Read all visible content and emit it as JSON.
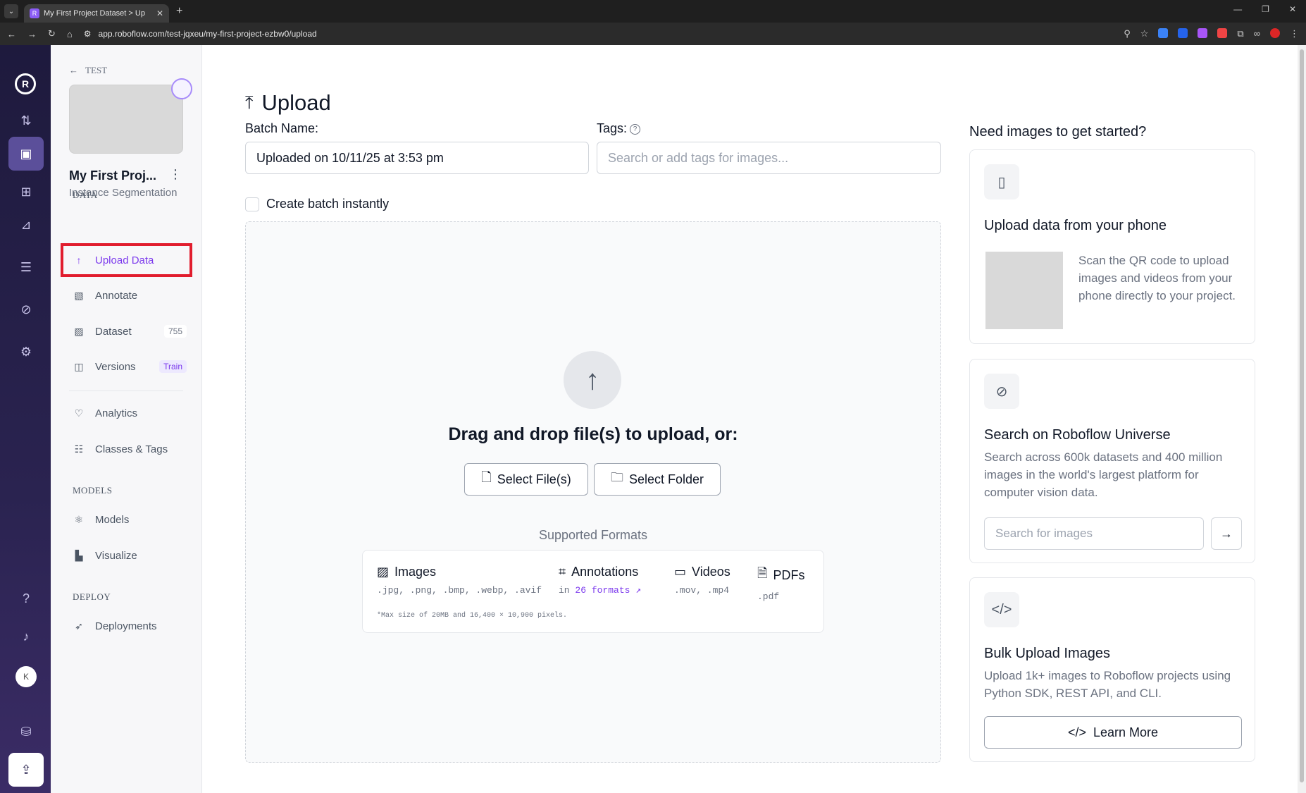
{
  "browser": {
    "tab_title": "My First Project Dataset > Up",
    "tab_favicon": "R",
    "new_tab": "+",
    "url": "app.roboflow.com/test-jqxeu/my-first-project-ezbw0/upload"
  },
  "rail": {
    "logo": "R",
    "avatar": "K"
  },
  "sidebar": {
    "workspace": "TEST",
    "project_name": "My First Proj...",
    "project_type": "Instance Segmentation",
    "sections": {
      "data": "DATA",
      "models": "MODELS",
      "deploy": "DEPLOY"
    },
    "items": {
      "upload": "Upload Data",
      "annotate": "Annotate",
      "dataset": "Dataset",
      "dataset_count": "755",
      "versions": "Versions",
      "versions_badge": "Train",
      "analytics": "Analytics",
      "classes": "Classes & Tags",
      "models": "Models",
      "visualize": "Visualize",
      "deployments": "Deployments"
    }
  },
  "main": {
    "title": "Upload",
    "batch_label": "Batch Name:",
    "batch_value": "Uploaded on 10/11/25 at 3:53 pm",
    "tags_label": "Tags:",
    "tags_placeholder": "Search or add tags for images...",
    "create_batch": "Create batch instantly",
    "dropzone_text": "Drag and drop file(s) to upload, or:",
    "select_files": "Select File(s)",
    "select_folder": "Select Folder",
    "formats_title": "Supported Formats",
    "formats": {
      "images": "Images",
      "images_ext": ".jpg, .png, .bmp, .webp, .avif",
      "annotations": "Annotations",
      "annotations_prefix": "in",
      "annotations_link": "26 formats",
      "videos": "Videos",
      "videos_ext": ".mov, .mp4",
      "pdfs": "PDFs",
      "pdfs_ext": ".pdf",
      "note": "*Max size of 20MB and 16,400 × 10,900 pixels."
    }
  },
  "right": {
    "title": "Need images to get started?",
    "phone": {
      "heading": "Upload data from your phone",
      "text": "Scan the QR code to upload images and videos from your phone directly to your project."
    },
    "universe": {
      "heading": "Search on Roboflow Universe",
      "text": "Search across 600k datasets and 400 million images in the world's largest platform for computer vision data.",
      "search_placeholder": "Search for images"
    },
    "bulk": {
      "heading": "Bulk Upload Images",
      "text": "Upload 1k+ images to Roboflow projects using Python SDK, REST API, and CLI.",
      "button": "Learn More"
    }
  },
  "colors": {
    "accent": "#7c3aed",
    "highlight": "#e11d2e",
    "rail": "#2a2350"
  }
}
